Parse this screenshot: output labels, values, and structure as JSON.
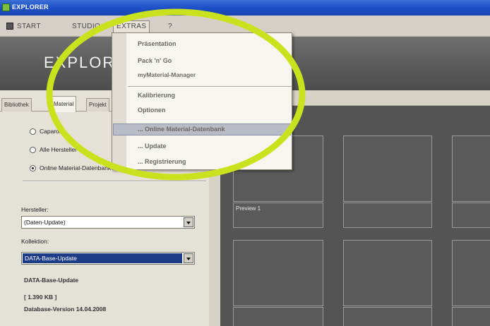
{
  "window": {
    "title": "EXPLORER"
  },
  "menubar": {
    "items": [
      "START",
      "STUDIO",
      "EXTRAS",
      "?"
    ]
  },
  "banner": {
    "brand": "EXPLORE"
  },
  "tabs": [
    "Bibliothek",
    "Material",
    "Projekt"
  ],
  "radios": [
    {
      "label": "Caparol",
      "selected": false
    },
    {
      "label": "Alle Hersteller",
      "selected": false
    },
    {
      "label": "Online Material-Datenbank",
      "selected": true
    }
  ],
  "fields": {
    "hersteller_label": "Hersteller:",
    "hersteller_value": "(Daten-Update)",
    "kollektion_label": "Kollektion:",
    "kollektion_value": "DATA-Base-Update"
  },
  "info": {
    "name": "DATA-Base-Update",
    "size": "[ 1.390 KB ]",
    "version": "Database-Version 14.04.2008"
  },
  "preview": {
    "tile_label": "Preview 1"
  },
  "extras_menu": {
    "items": [
      "Präsentation",
      "Pack 'n' Go",
      "myMaterial-Manager",
      "Kalibrierung",
      "Optionen",
      "... Online Material-Datenbank",
      "... Update",
      "... Registrierung"
    ],
    "highlighted": "... Online Material-Datenbank"
  },
  "colors": {
    "highlight_circle": "#c8e31e",
    "selection": "#1d3c88",
    "titlebar": "#1f50c8"
  }
}
